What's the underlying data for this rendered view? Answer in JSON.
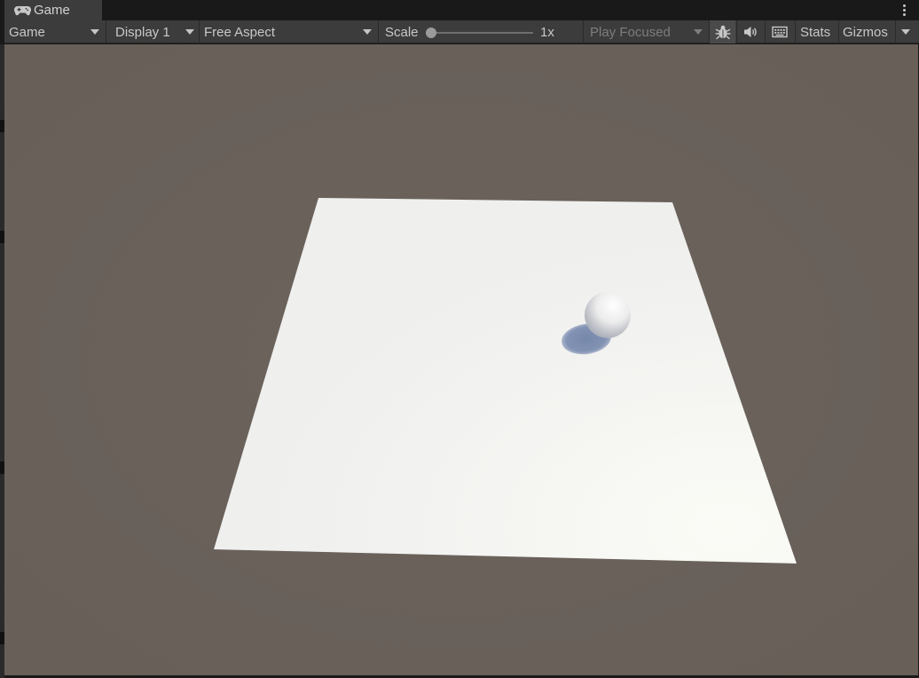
{
  "window": {
    "tab_title": "Game",
    "tab_icon": "gamepad-icon"
  },
  "toolbar": {
    "view_mode": "Game",
    "display": "Display 1",
    "aspect": "Free Aspect",
    "scale_label": "Scale",
    "scale_value": "1x",
    "play_mode": "Play Focused",
    "stats_label": "Stats",
    "gizmos_label": "Gizmos",
    "icons": [
      "bug-icon",
      "speaker-icon",
      "keyboard-icon"
    ]
  },
  "scene": {
    "background_color": "#6a625b",
    "plane_color": "#f4f4f1",
    "sphere_color": "#f2f2f2",
    "shadow_color": "#7f8fb0"
  }
}
